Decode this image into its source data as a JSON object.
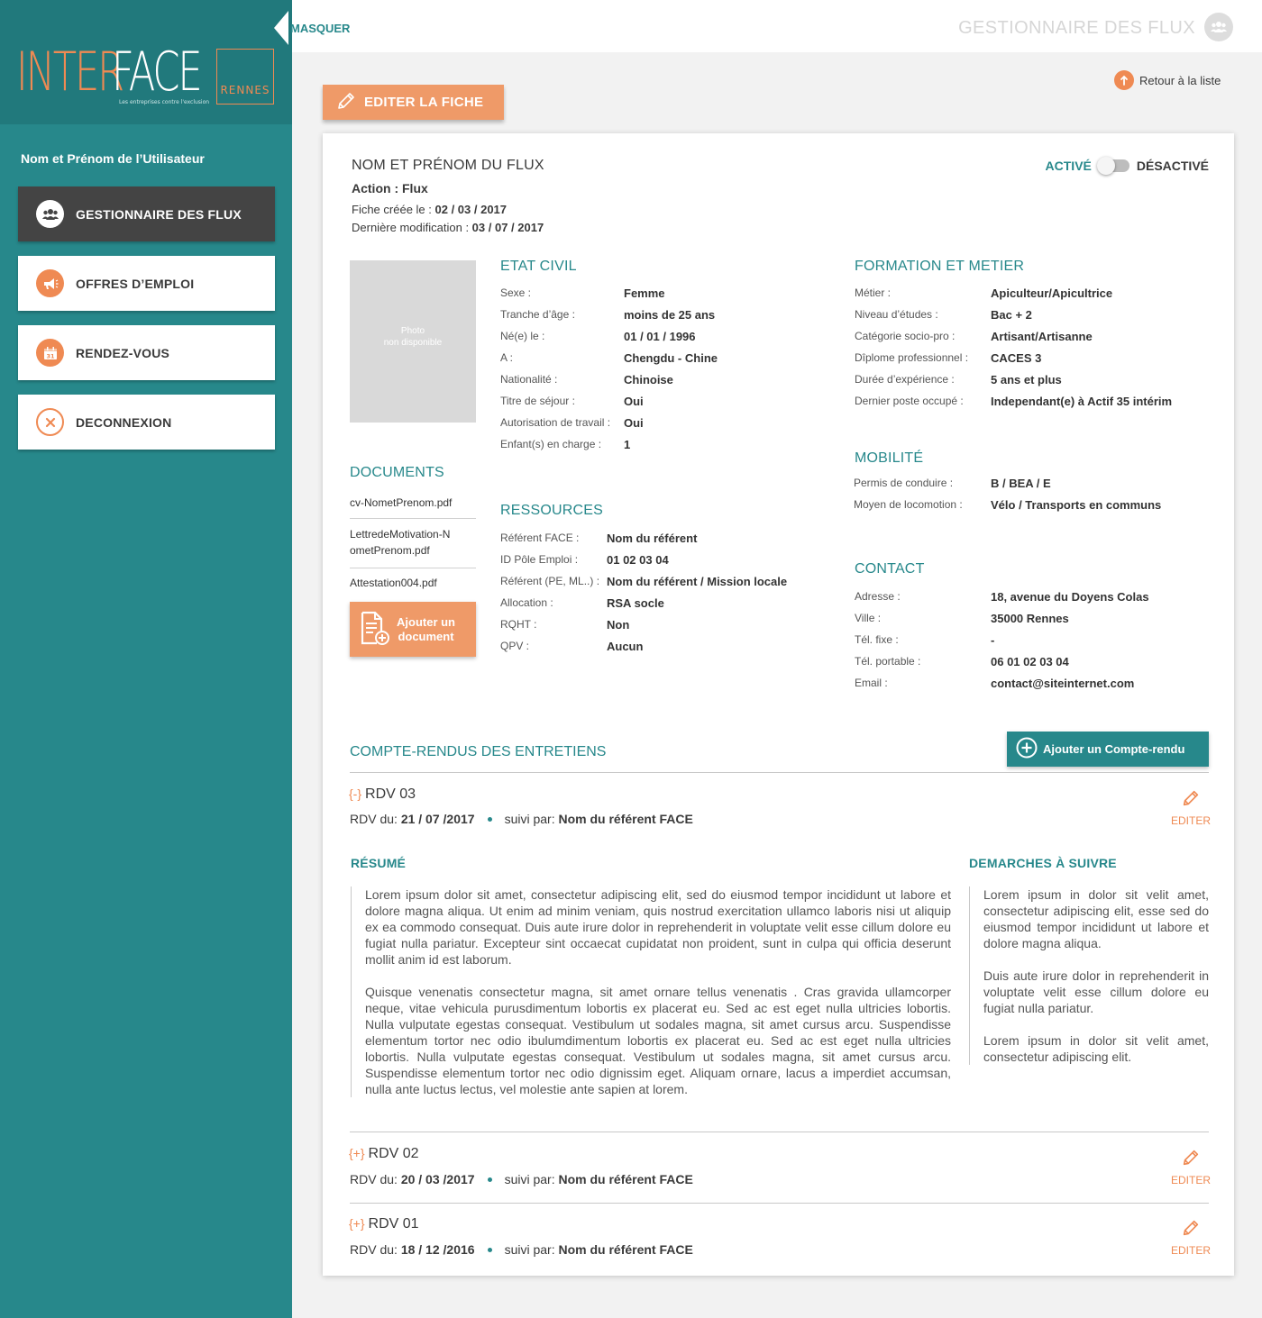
{
  "sidebar": {
    "logo": {
      "inter": "INTER",
      "face": "FACE",
      "city": "RENNES",
      "tagline": "Les entreprises contre l'exclusion"
    },
    "user_name": "Nom et Prénom de l’Utilisateur",
    "items": [
      {
        "label": "GESTIONNAIRE DES FLUX",
        "icon": "users-icon"
      },
      {
        "label": "OFFRES D’EMPLOI",
        "icon": "megaphone-icon"
      },
      {
        "label": "RENDEZ-VOUS",
        "icon": "calendar-icon"
      },
      {
        "label": "DECONNEXION",
        "icon": "close-icon"
      }
    ],
    "collapse_label": "MASQUER"
  },
  "header": {
    "title": "GESTIONNAIRE DES FLUX"
  },
  "toolbar": {
    "edit_label": "EDITER LA FICHE",
    "back_label": "Retour à la liste"
  },
  "fiche": {
    "name": "NOM ET PRÉNOM DU FLUX",
    "action_label": "Action : ",
    "action_value": "Flux",
    "created_label": "Fiche créée le : ",
    "created_value": "02 / 03 / 2017",
    "modified_label": "Dernière modification : ",
    "modified_value": "03 / 07 / 2017",
    "status_active": "ACTIVÉ",
    "status_inactive": "DÉSACTIVÉ",
    "photo_text_1": "Photo",
    "photo_text_2": "non disponible"
  },
  "etat_civil": {
    "title": "ETAT CIVIL",
    "rows": [
      {
        "k": "Sexe :",
        "v": "Femme"
      },
      {
        "k": "Tranche d’âge :",
        "v": "moins de 25 ans"
      },
      {
        "k": "Né(e) le :",
        "v": "01 / 01 / 1996"
      },
      {
        "k": "A :",
        "v": "Chengdu - Chine"
      },
      {
        "k": "Nationalité :",
        "v": "Chinoise"
      },
      {
        "k": "Titre de séjour :",
        "v": "Oui"
      },
      {
        "k": "Autorisation de travail :",
        "v": "Oui"
      },
      {
        "k": "Enfant(s) en charge :",
        "v": "1"
      }
    ]
  },
  "formation": {
    "title": "FORMATION ET METIER",
    "rows": [
      {
        "k": "Métier :",
        "v": "Apiculteur/Apicultrice"
      },
      {
        "k": "Niveau d’études :",
        "v": "Bac + 2"
      },
      {
        "k": "Catégorie socio-pro :",
        "v": "Artisant/Artisanne"
      },
      {
        "k": "Dîplome professionnel :",
        "v": "CACES 3"
      },
      {
        "k": "Durée d’expérience :",
        "v": "5 ans et plus"
      },
      {
        "k": "Dernier poste occupé :",
        "v": "Independant(e) à Actif 35 intérim"
      }
    ]
  },
  "mobilite": {
    "title": "MOBILITÉ",
    "rows": [
      {
        "k": "Permis de conduire :",
        "v": "B / BEA / E"
      },
      {
        "k": "Moyen de locomotion :",
        "v": "Vélo / Transports en communs"
      }
    ]
  },
  "documents": {
    "title": "DOCUMENTS",
    "items": [
      "cv-NometPrenom.pdf",
      "LettredeMotivation-NometPrenom.pdf",
      "Attestation004.pdf"
    ],
    "item2_line1": "LettredeMotivation-N",
    "item2_line2": "ometPrenom.pdf",
    "add_line1": "Ajouter un",
    "add_line2": "document"
  },
  "ressources": {
    "title": "RESSOURCES",
    "rows": [
      {
        "k": "Référent FACE :",
        "v": "Nom du référent"
      },
      {
        "k": "ID Pôle Emploi :",
        "v": "01 02 03 04"
      },
      {
        "k": "Référent (PE, ML..) :",
        "v": "Nom du référent / Mission locale"
      },
      {
        "k": "Allocation :",
        "v": "RSA socle"
      },
      {
        "k": "RQHT :",
        "v": "Non"
      },
      {
        "k": "QPV :",
        "v": "Aucun"
      }
    ]
  },
  "contact": {
    "title": "CONTACT",
    "rows": [
      {
        "k": "Adresse :",
        "v": "18, avenue du Doyens Colas"
      },
      {
        "k": "Ville :",
        "v": "35000 Rennes"
      },
      {
        "k": "Tél. fixe :",
        "v": "-"
      },
      {
        "k": "Tél. portable :",
        "v": "06 01 02 03 04"
      },
      {
        "k": "Email :",
        "v": "contact@siteinternet.com"
      }
    ]
  },
  "compte_rendus": {
    "title": "COMPTE-RENDUS DES ENTRETIENS",
    "add_label": "Ajouter un Compte-rendu",
    "edit_label": "EDITER",
    "date_prefix": "RDV du: ",
    "by_prefix": "suivi par: ",
    "rdvs": [
      {
        "toggle": "{-}",
        "title": "RDV 03",
        "date": "21 / 07 /2017",
        "referent": "Nom du référent FACE"
      },
      {
        "toggle": "{+}",
        "title": "RDV 02",
        "date": "20 / 03 /2017",
        "referent": "Nom du référent FACE"
      },
      {
        "toggle": "{+}",
        "title": "RDV 01",
        "date": "18 / 12 /2016",
        "referent": "Nom du référent FACE"
      }
    ],
    "resume_title": "RÉSUMÉ",
    "resume_paragraphs": [
      "Lorem ipsum dolor sit amet, consectetur adipiscing elit, sed do eiusmod tempor incididunt ut labore et dolore magna aliqua. Ut enim ad minim veniam, quis nostrud exercitation ullamco laboris nisi ut aliquip ex ea commodo consequat. Duis aute irure dolor in reprehenderit in voluptate velit esse cillum dolore eu fugiat nulla pariatur. Excepteur sint occaecat cupidatat non proident, sunt in culpa qui officia deserunt mollit anim id est laborum.",
      "Quisque venenatis consectetur magna, sit amet ornare tellus venenatis . Cras gravida ullamcorper neque, vitae vehicula purusdimentum lobortis ex placerat eu. Sed ac est eget nulla ultricies lobortis. Nulla vulputate egestas consequat. Vestibulum ut sodales magna, sit amet cursus arcu. Suspendisse elementum tortor nec odio ibulumdimentum lobortis ex placerat eu. Sed ac est eget nulla ultricies lobortis. Nulla vulputate egestas consequat. Vestibulum ut sodales magna, sit amet cursus arcu. Suspendisse elementum tortor nec odio  dignissim eget. Aliquam ornare, lacus a imperdiet accumsan, nulla ante luctus lectus, vel molestie ante sapien at lorem."
    ],
    "demarches_title": "DEMARCHES À SUIVRE",
    "demarches_paragraphs": [
      "Lorem ipsum in dolor sit velit amet, consectetur adipiscing elit, esse sed do eiusmod tempor incididunt ut labore et dolore magna aliqua.",
      "Duis aute irure dolor in reprehenderit in voluptate velit esse cillum dolore eu fugiat nulla pariatur.",
      "Lorem ipsum in dolor sit velit amet, consectetur adipiscing elit."
    ]
  }
}
